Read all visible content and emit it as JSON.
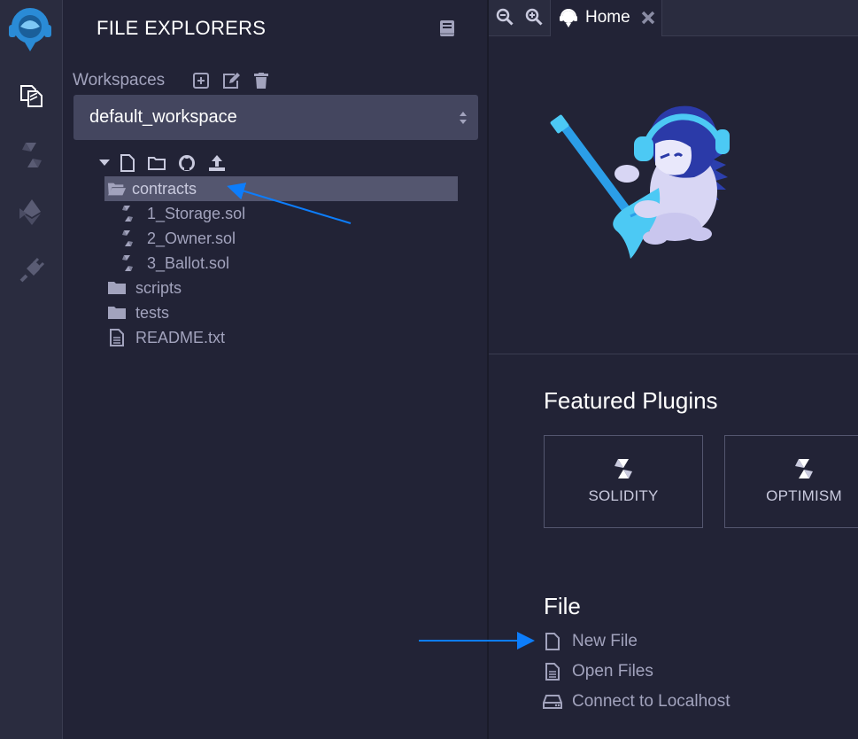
{
  "rail": {
    "items": [
      {
        "name": "file-explorer-icon"
      },
      {
        "name": "solidity-compiler-icon"
      },
      {
        "name": "deploy-run-icon"
      },
      {
        "name": "plugin-manager-icon"
      }
    ]
  },
  "explorer": {
    "title": "FILE EXPLORERS",
    "workspaces_label": "Workspaces",
    "workspace_selected": "default_workspace",
    "tree": [
      {
        "label": "contracts",
        "type": "folder-open",
        "depth": 0,
        "selected": true
      },
      {
        "label": "1_Storage.sol",
        "type": "sol",
        "depth": 1
      },
      {
        "label": "2_Owner.sol",
        "type": "sol",
        "depth": 1
      },
      {
        "label": "3_Ballot.sol",
        "type": "sol",
        "depth": 1
      },
      {
        "label": "scripts",
        "type": "folder",
        "depth": 0
      },
      {
        "label": "tests",
        "type": "folder",
        "depth": 0
      },
      {
        "label": "README.txt",
        "type": "file",
        "depth": 0
      }
    ]
  },
  "main": {
    "tab_label": "Home",
    "featured_title": "Featured Plugins",
    "plugins": [
      {
        "label": "SOLIDITY"
      },
      {
        "label": "OPTIMISM"
      }
    ],
    "file_title": "File",
    "file_actions": [
      {
        "label": "New File"
      },
      {
        "label": "Open Files"
      },
      {
        "label": "Connect to Localhost"
      }
    ]
  },
  "colors": {
    "background": "#222336",
    "rail": "#2a2c3f",
    "muted_text": "#a2a3bd",
    "accent_arrow": "#0d7dfb",
    "selected_row": "#54566f"
  }
}
